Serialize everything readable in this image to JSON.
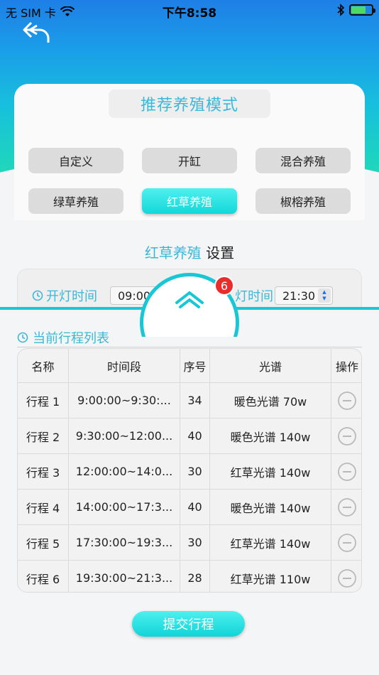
{
  "status": {
    "carrier": "无 SIM 卡",
    "time": "下午8:58"
  },
  "header": {
    "title": "推荐养殖模式"
  },
  "modes": [
    {
      "label": "自定义",
      "active": false
    },
    {
      "label": "开缸",
      "active": false
    },
    {
      "label": "混合养殖",
      "active": false
    },
    {
      "label": "绿草养殖",
      "active": false
    },
    {
      "label": "红草养殖",
      "active": true
    },
    {
      "label": "椒榕养殖",
      "active": false
    }
  ],
  "settings": {
    "mode_name": "红草养殖",
    "suffix": "设置"
  },
  "light": {
    "on_label": "开灯时间",
    "on_value": "09:00",
    "off_label": "关灯时间",
    "off_label_visible": "灯时间",
    "off_value": "21:30"
  },
  "badge": {
    "count": "6"
  },
  "schedule": {
    "title": "当前行程列表",
    "columns": [
      "名称",
      "时间段",
      "序号",
      "光谱",
      "操作"
    ],
    "rows": [
      {
        "name": "行程 1",
        "period": "9:00:00~9:30:...",
        "seq": "34",
        "spectrum": "暖色光谱 70w"
      },
      {
        "name": "行程 2",
        "period": "9:30:00~12:00...",
        "seq": "40",
        "spectrum": "暖色光谱 140w"
      },
      {
        "name": "行程 3",
        "period": "12:00:00~14:0...",
        "seq": "30",
        "spectrum": "红草光谱 140w"
      },
      {
        "name": "行程 4",
        "period": "14:00:00~17:3...",
        "seq": "40",
        "spectrum": "暖色光谱 140w"
      },
      {
        "name": "行程 5",
        "period": "17:30:00~19:3...",
        "seq": "30",
        "spectrum": "红草光谱 140w"
      },
      {
        "name": "行程 6",
        "period": "19:30:00~21:3...",
        "seq": "28",
        "spectrum": "红草光谱 110w"
      }
    ]
  },
  "submit": {
    "label": "提交行程"
  },
  "colors": {
    "accent": "#3bb8d8",
    "button_active": "#1ed8d8",
    "badge": "#e92d2d"
  },
  "icons": {
    "back": "back-arrow-icon",
    "clock": "clock-icon",
    "remove": "minus-circle-icon",
    "collapse": "chevron-up-icon"
  }
}
